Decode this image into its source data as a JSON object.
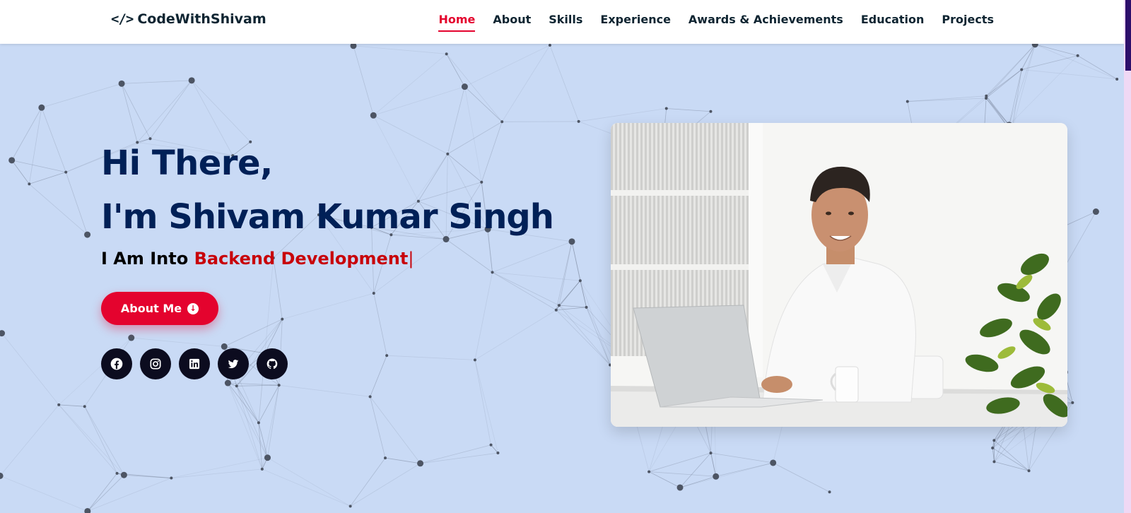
{
  "header": {
    "brand": "CodeWithShivam",
    "brand_icon": "code-icon",
    "nav": [
      {
        "label": "Home",
        "active": true
      },
      {
        "label": "About",
        "active": false
      },
      {
        "label": "Skills",
        "active": false
      },
      {
        "label": "Experience",
        "active": false
      },
      {
        "label": "Awards & Achievements",
        "active": false
      },
      {
        "label": "Education",
        "active": false
      },
      {
        "label": "Projects",
        "active": false
      }
    ]
  },
  "hero": {
    "greeting": "Hi There,",
    "name": "I'm Shivam Kumar Singh",
    "typed_prefix": "I Am Into",
    "typed_role": "Backend Development",
    "typed_cursor": "|",
    "about_button": "About Me",
    "socials": [
      "facebook-icon",
      "instagram-icon",
      "linkedin-icon",
      "twitter-icon",
      "github-icon"
    ]
  },
  "colors": {
    "accent": "#e4032e",
    "heading": "#002057",
    "background": "#c9daf5",
    "nav_text": "#0e2431",
    "social_bg": "#0c0c1f"
  }
}
